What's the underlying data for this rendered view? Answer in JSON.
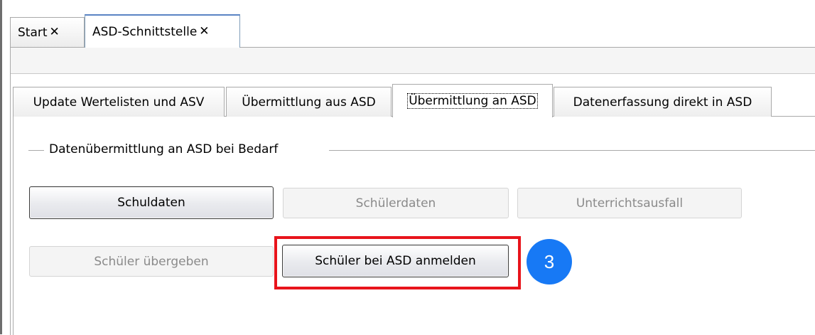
{
  "doc_tabs": [
    {
      "label": "Start",
      "close": "✕"
    },
    {
      "label": "ASD-Schnittstelle",
      "close": "✕"
    }
  ],
  "inner_tabs": [
    {
      "label": "Update Wertelisten und ASV"
    },
    {
      "label": "Übermittlung aus ASD"
    },
    {
      "label": "Übermittlung an ASD"
    },
    {
      "label": "Datenerfassung direkt in ASD"
    }
  ],
  "group": {
    "title": "Datenübermittlung an ASD bei Bedarf"
  },
  "buttons": {
    "schuldaten": "Schuldaten",
    "schuelerdaten": "Schülerdaten",
    "unterrichtsausfall": "Unterrichtsausfall",
    "schueler_uebergeben": "Schüler übergeben",
    "schueler_anmelden": "Schüler bei ASD anmelden"
  },
  "annotation": {
    "step": "3",
    "highlight_color": "#e8141b",
    "badge_color": "#1779f5"
  }
}
